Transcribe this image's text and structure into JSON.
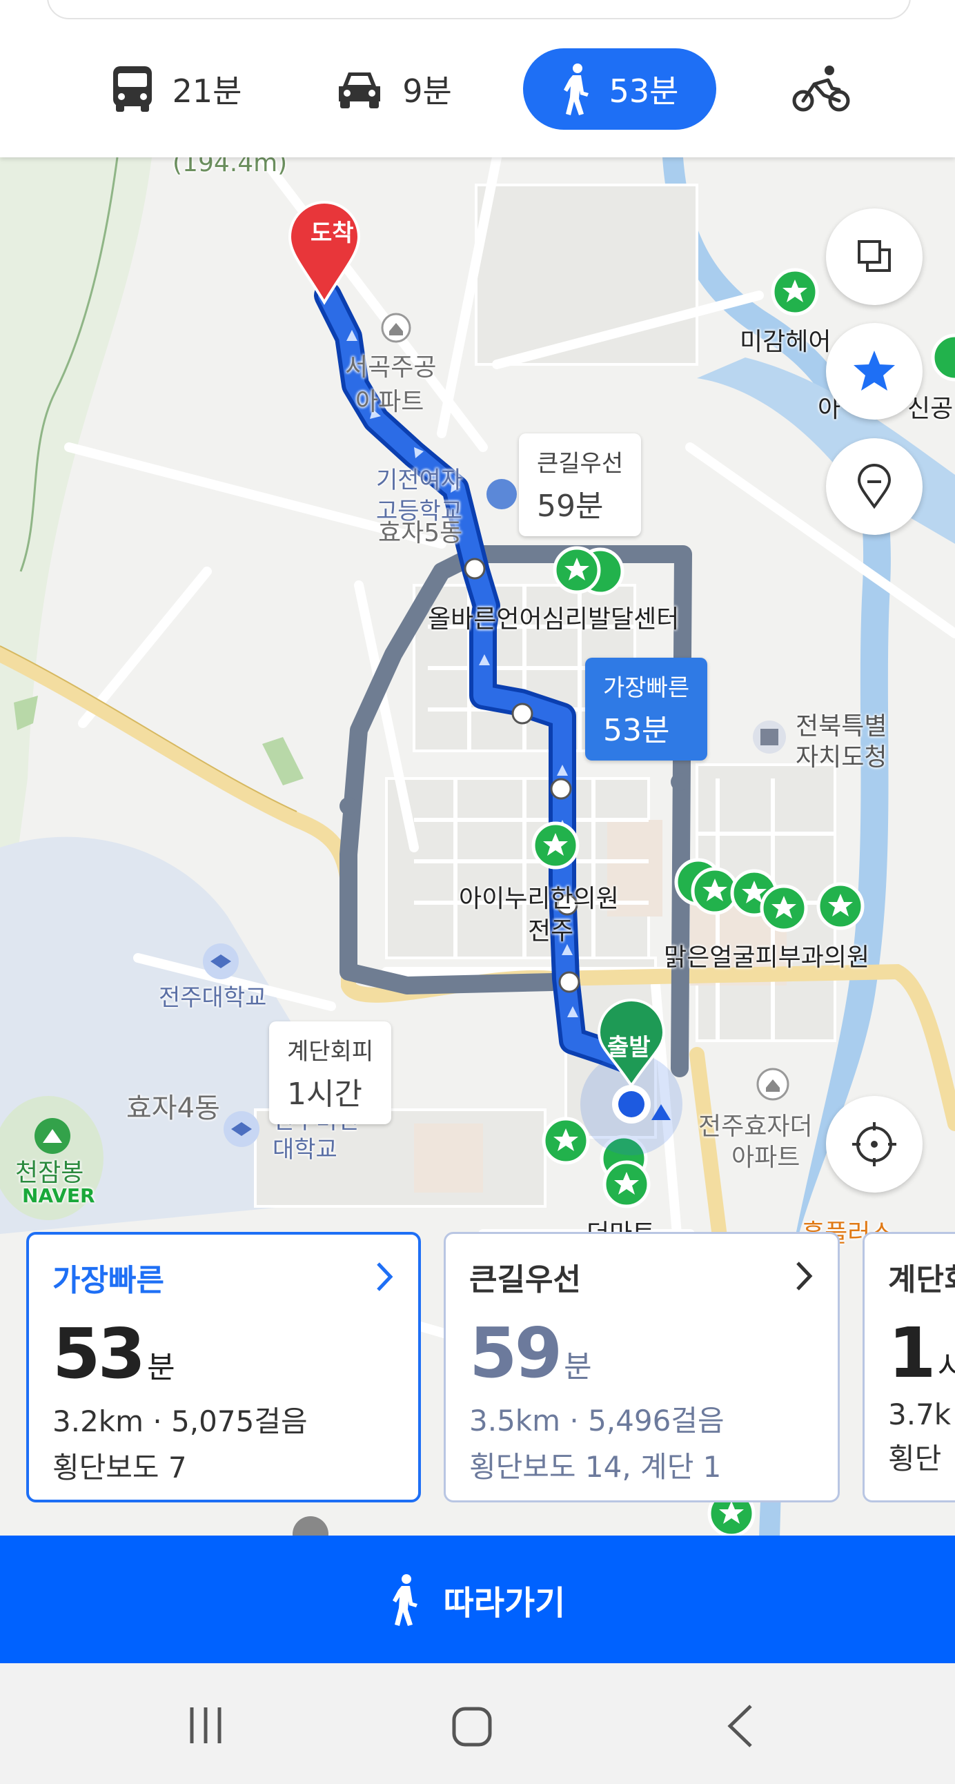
{
  "modes": [
    {
      "icon": "bus-icon",
      "label": "21분"
    },
    {
      "icon": "car-icon",
      "label": "9분"
    },
    {
      "icon": "walk-icon",
      "label": "53분",
      "active": true
    },
    {
      "icon": "bicycle-icon",
      "label": ""
    }
  ],
  "map": {
    "elevation_label": "(194.4m)",
    "destination_pin": "도착",
    "start_pin": "출발",
    "places": {
      "apt_line1": "서곡주공",
      "apt_line2": "아파트",
      "school_line1": "기전여자",
      "school_line2": "고등학교",
      "dong_hyoja5": "효자5동",
      "center": "올바른언어심리발달센터",
      "clinic_line1": "아이누리한의원",
      "clinic_line2": "전주",
      "skin_clinic": "맑은얼굴피부과의원",
      "gov_line1": "전북특별",
      "gov_line2": "자치도청",
      "univ": "전주대학교",
      "dong_hyoja4": "효자4동",
      "college_line1": "전주비전",
      "college_line2": "대학교",
      "mountain": "천잠봉",
      "apt2_line1": "전주효자더",
      "apt2_line2": "아파트",
      "hair": "미감헤어",
      "partial_right": "아",
      "partial_right2": "신공",
      "partial_bottom": "더마트",
      "home_plus": "홈플러스",
      "naver": "NAVER"
    },
    "bubbles": {
      "main_road": {
        "title": "큰길우선",
        "time": "59분"
      },
      "fastest": {
        "title": "가장빠른",
        "time": "53분"
      },
      "stairs": {
        "title": "계단회피",
        "time": "1시간"
      }
    }
  },
  "cards": [
    {
      "label": "가장빠른",
      "time_num": "53",
      "time_unit": "분",
      "distance": "3.2km · 5,075걸음",
      "detail": "횡단보도 7"
    },
    {
      "label": "큰길우선",
      "time_num": "59",
      "time_unit": "분",
      "distance": "3.5km · 5,496걸음",
      "detail": "횡단보도 14, 계단 1"
    },
    {
      "label": "계단회",
      "time_num": "1",
      "time_unit": "시",
      "distance": "3.7k",
      "detail": "횡단"
    }
  ],
  "follow_button": "따라가기",
  "colors": {
    "accent": "#1e6ff5",
    "route": "#1d5ae0",
    "alt_route": "#6f7d92",
    "poi_green": "#22b24c",
    "destination": "#e8363a",
    "start": "#1e9a55"
  }
}
